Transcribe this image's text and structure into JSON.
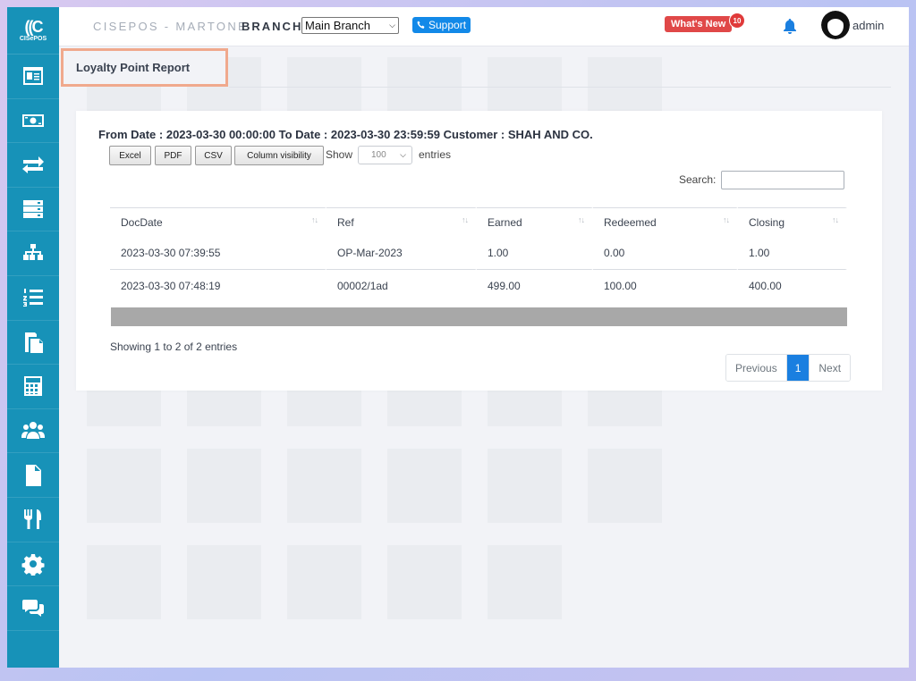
{
  "brand": {
    "logo_text": "CISePOS",
    "name": "CISEPOS - MARTONE"
  },
  "topbar": {
    "branch_label": "BRANCH",
    "branch_select": "Main Branch",
    "support_label": "Support",
    "whats_new_label": "What's New",
    "whats_new_count": "10",
    "user_name": "admin"
  },
  "sidebar": {
    "items": [
      {
        "icon": "dashboard-icon"
      },
      {
        "icon": "money-icon"
      },
      {
        "icon": "transfer-icon"
      },
      {
        "icon": "server-icon"
      },
      {
        "icon": "sitemap-icon"
      },
      {
        "icon": "list-ordered-icon"
      },
      {
        "icon": "copy-icon"
      },
      {
        "icon": "calculator-icon"
      },
      {
        "icon": "users-icon"
      },
      {
        "icon": "file-icon"
      },
      {
        "icon": "utensils-icon"
      },
      {
        "icon": "settings-icon"
      },
      {
        "icon": "chat-icon"
      }
    ]
  },
  "page": {
    "title": "Loyalty Point Report"
  },
  "report": {
    "filter_line": "From Date : 2023-03-30 00:00:00 To Date : 2023-03-30 23:59:59 Customer : SHAH AND CO.",
    "buttons": {
      "excel": "Excel",
      "pdf": "PDF",
      "csv": "CSV",
      "column_visibility": "Column visibility"
    },
    "show_label": "Show",
    "page_length": "100",
    "entries_label": "entries",
    "search_label": "Search:",
    "search_value": "",
    "columns": [
      "DocDate",
      "Ref",
      "Earned",
      "Redeemed",
      "Closing"
    ],
    "rows": [
      [
        "2023-03-30 07:39:55",
        "OP-Mar-2023",
        "1.00",
        "0.00",
        "1.00"
      ],
      [
        "2023-03-30 07:48:19",
        "00002/1ad",
        "499.00",
        "100.00",
        "400.00"
      ]
    ],
    "info": "Showing 1 to 2 of 2 entries",
    "pagination": {
      "previous": "Previous",
      "current": "1",
      "next": "Next"
    }
  },
  "colors": {
    "sidebar": "#1792b8",
    "accent": "#1a7fe0",
    "highlight_border": "#f0a98d",
    "badge": "#e04848"
  }
}
